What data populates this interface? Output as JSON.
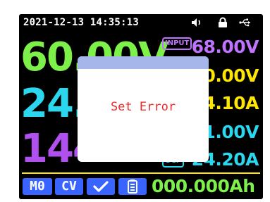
{
  "status": {
    "datetime": "2021-12-13 14:35:13",
    "icons": [
      "speaker-icon",
      "lock-icon",
      "usb-icon"
    ]
  },
  "readouts": {
    "voltage_main": "60.00V",
    "current_main": "24.",
    "power_main": "144",
    "input_tag": "INPUT",
    "input_voltage": "68.00V",
    "set_voltage": "0.00V",
    "set_current": "4.10A",
    "ovp_value": "1.00V",
    "ocp_tag": "OCP",
    "ocp_value": "24.20A"
  },
  "bottom": {
    "memory_label": "M0",
    "mode_label": "CV",
    "energy": "000.000Ah"
  },
  "dialog": {
    "message": "Set Error"
  },
  "colors": {
    "voltage": "#7ef04a",
    "current": "#2ad7ef",
    "power": "#b050ef",
    "set_values": "#ffe600",
    "input": "#c073ff",
    "button_bg": "#3a64ff",
    "error_text": "#ee2a2a",
    "dialog_header": "#a6b6ea"
  }
}
